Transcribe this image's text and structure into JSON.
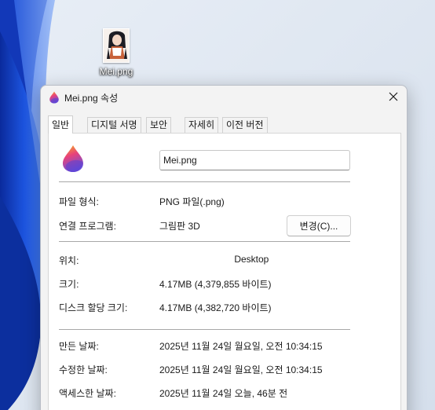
{
  "desktop": {
    "icon_label": "Mei.png"
  },
  "dialog": {
    "title": "Mei.png 속성",
    "tabs": [
      {
        "label": "일반",
        "active": true
      },
      {
        "label": "디지털 서명",
        "active": false
      },
      {
        "label": "보안",
        "active": false
      },
      {
        "label": "자세히",
        "active": false
      },
      {
        "label": "이전 버전",
        "active": false
      }
    ],
    "general": {
      "file_name": "Mei.png",
      "file_type_label": "파일 형식:",
      "file_type_value": "PNG 파일(.png)",
      "opens_with_label": "연결 프로그램:",
      "opens_with_value": "그림판 3D",
      "change_button": "변경(C)...",
      "location_label": "위치:",
      "location_value": "\\Desktop",
      "size_label": "크기:",
      "size_value": "4.17MB (4,379,855 바이트)",
      "size_on_disk_label": "디스크 할당 크기:",
      "size_on_disk_value": "4.17MB (4,382,720 바이트)",
      "created_label": "만든 날짜:",
      "created_value": "2025년 11월 24일 월요일, 오전 10:34:15",
      "modified_label": "수정한 날짜:",
      "modified_value": "2025년 11월 24일 월요일, 오전 10:34:15",
      "accessed_label": "액세스한 날짜:",
      "accessed_value": "2025년 11월 24일 오늘, 46분 전"
    }
  },
  "icons": {
    "app_icon": "paint3d-drop-icon",
    "close": "close-icon"
  },
  "colors": {
    "drop_top": "#f5b21a",
    "drop_mid": "#e5407a",
    "drop_bottom": "#6b4fd8",
    "wallpaper_blue": "#1c4fd6"
  }
}
